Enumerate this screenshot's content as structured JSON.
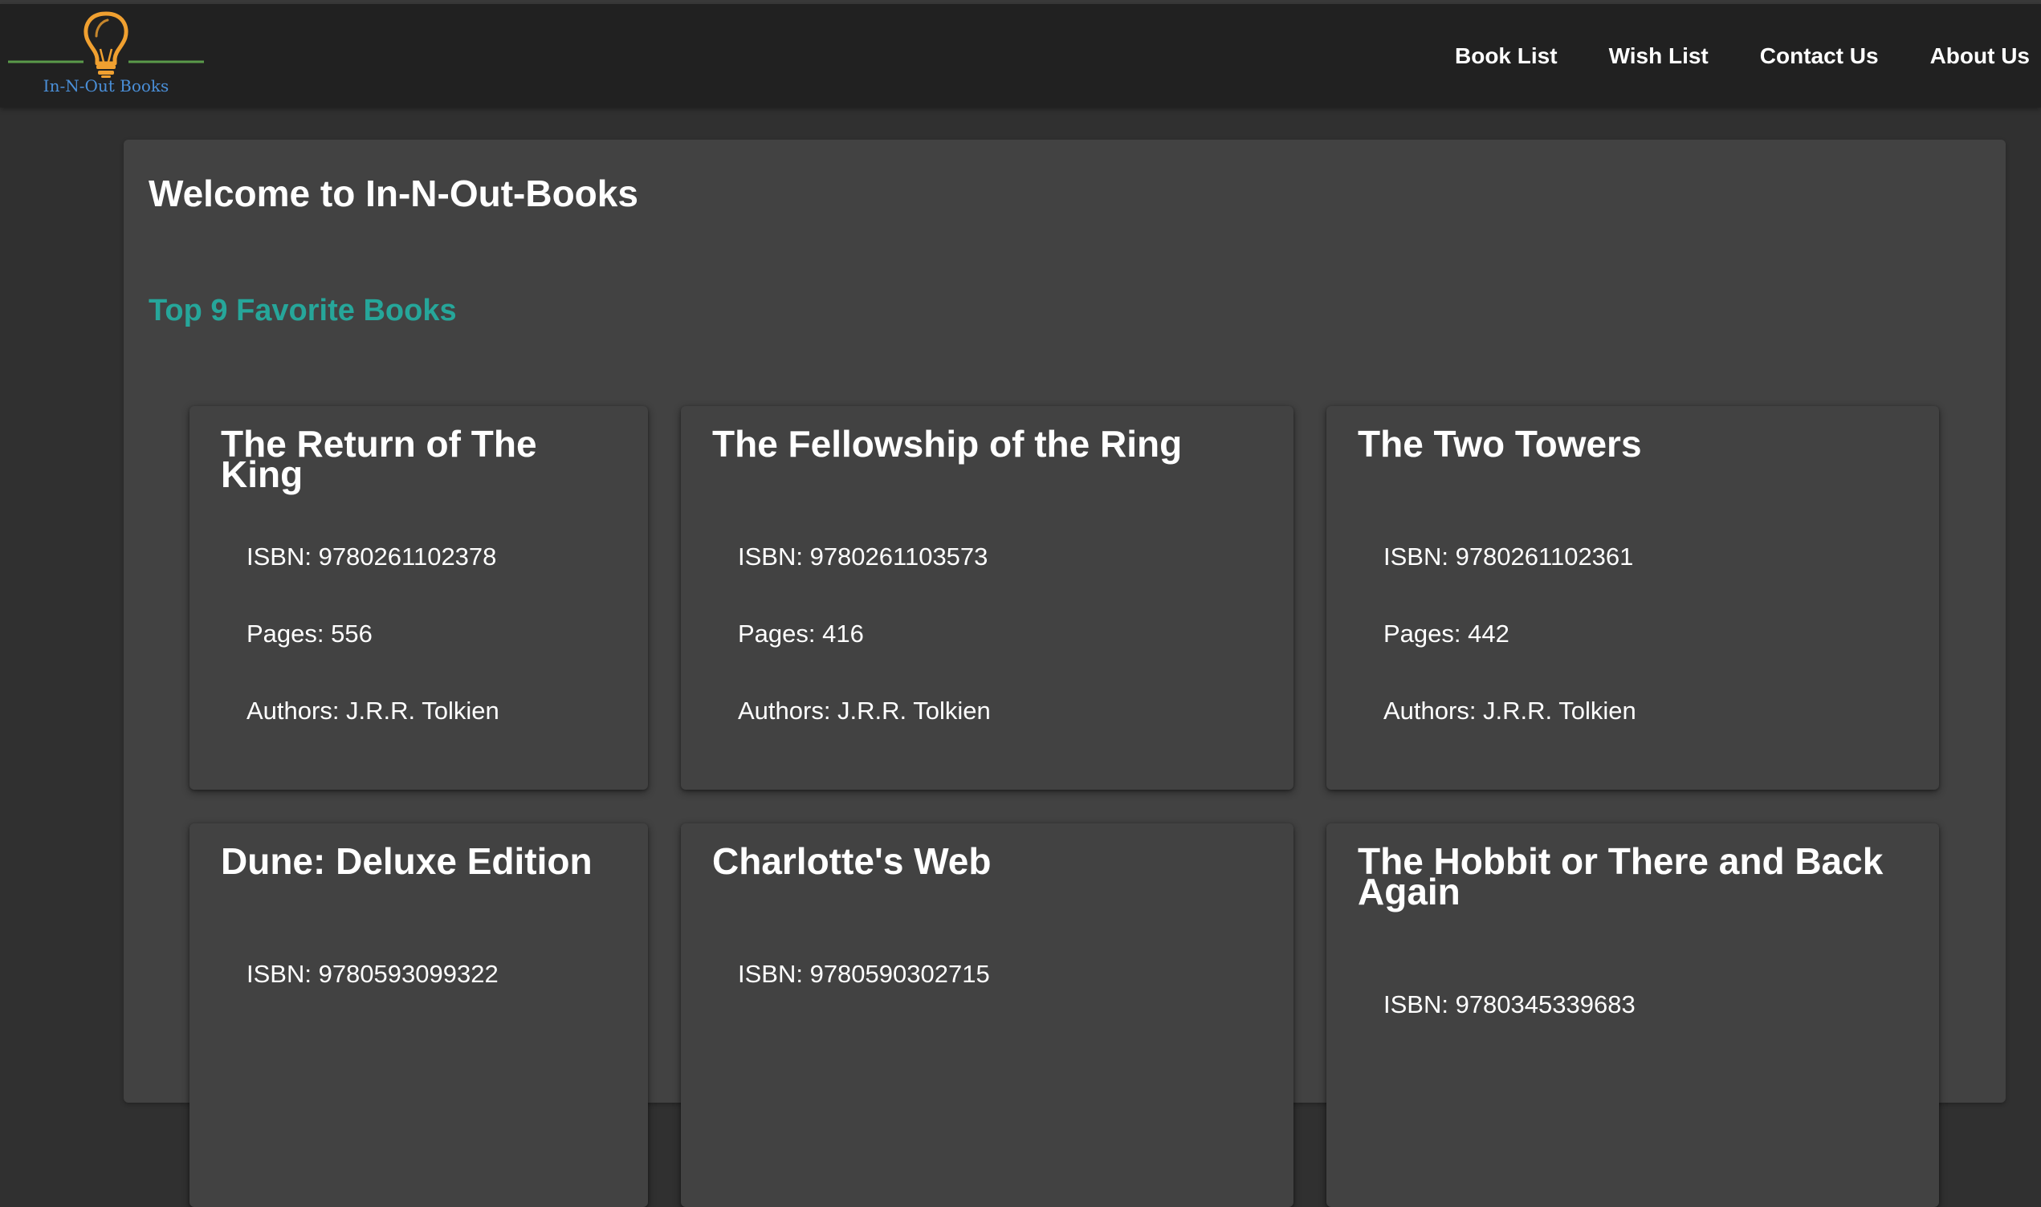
{
  "app": {
    "logo_text": "In-N-Out Books"
  },
  "nav": {
    "items": [
      {
        "label": "Book List"
      },
      {
        "label": "Wish List"
      },
      {
        "label": "Contact Us"
      },
      {
        "label": "About Us"
      }
    ]
  },
  "main": {
    "welcome": "Welcome to In-N-Out-Books",
    "subtitle": "Top 9 Favorite Books",
    "books": [
      {
        "title": "The Return of The King",
        "isbn": "ISBN: 9780261102378",
        "pages": "Pages: 556",
        "authors": "Authors: J.R.R. Tolkien"
      },
      {
        "title": "The Fellowship of the Ring",
        "isbn": "ISBN: 9780261103573",
        "pages": "Pages: 416",
        "authors": "Authors: J.R.R. Tolkien"
      },
      {
        "title": "The Two Towers",
        "isbn": "ISBN: 9780261102361",
        "pages": "Pages: 442",
        "authors": "Authors: J.R.R. Tolkien"
      },
      {
        "title": "Dune: Deluxe Edition",
        "isbn": "ISBN: 9780593099322"
      },
      {
        "title": "Charlotte's Web",
        "isbn": "ISBN: 9780590302715"
      },
      {
        "title": "The Hobbit or There and Back Again",
        "isbn": "ISBN: 9780345339683"
      }
    ]
  },
  "colors": {
    "page_bg": "#303030",
    "navbar_bg": "#212121",
    "card_bg": "#424242",
    "accent_teal": "#26a69a",
    "logo_bulb": "#f0a030",
    "logo_text": "#4a8fd8",
    "logo_line": "#5a9a4a"
  },
  "icons": {
    "logo": "lightbulb-icon"
  }
}
